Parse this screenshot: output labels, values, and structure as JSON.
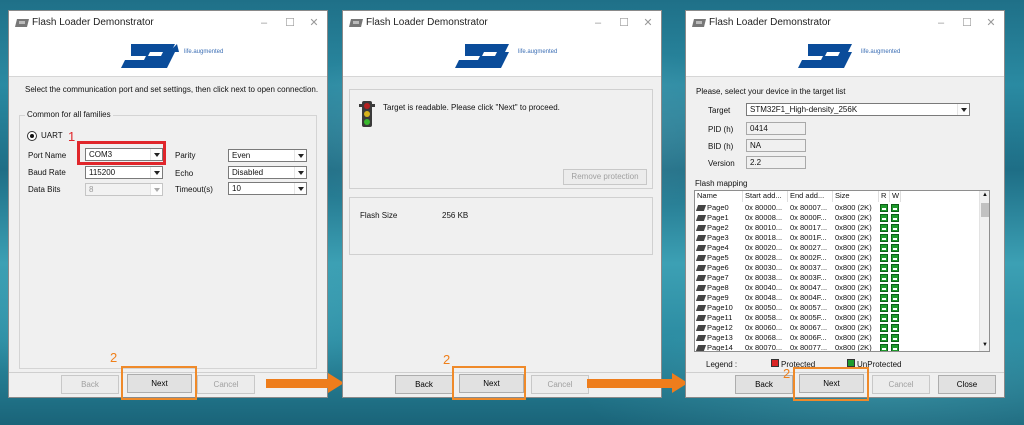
{
  "app_title": "Flash Loader Demonstrator",
  "brand": {
    "logo_text": "ST",
    "tagline": "life.augmented"
  },
  "window1": {
    "instruction": "Select the communication port and set settings, then click next to open connection.",
    "group_title": "Common for all families",
    "uart_label": "UART",
    "port_name_label": "Port Name",
    "port_name_value": "COM3",
    "baud_rate_label": "Baud Rate",
    "baud_rate_value": "115200",
    "data_bits_label": "Data Bits",
    "data_bits_value": "8",
    "parity_label": "Parity",
    "parity_value": "Even",
    "echo_label": "Echo",
    "echo_value": "Disabled",
    "timeout_label": "Timeout(s)",
    "timeout_value": "10",
    "buttons": {
      "back": "Back",
      "next": "Next",
      "cancel": "Cancel"
    }
  },
  "window2": {
    "status": "Target is readable. Please click \"Next\" to proceed.",
    "remove_protection": "Remove protection",
    "flash_size_label": "Flash Size",
    "flash_size_value": "256 KB",
    "buttons": {
      "back": "Back",
      "next": "Next",
      "cancel": "Cancel"
    }
  },
  "window3": {
    "instruction": "Please, select your device in the target list",
    "target_label": "Target",
    "target_value": "STM32F1_High-density_256K",
    "pid_label": "PID (h)",
    "pid_value": "0414",
    "bid_label": "BID (h)",
    "bid_value": "NA",
    "version_label": "Version",
    "version_value": "2.2",
    "flash_mapping_label": "Flash mapping",
    "columns": [
      "Name",
      "Start add...",
      "End add...",
      "Size",
      "R",
      "W"
    ],
    "rows": [
      {
        "name": "Page0",
        "start": "0x 80000...",
        "end": "0x 80007...",
        "size": "0x800 (2K)"
      },
      {
        "name": "Page1",
        "start": "0x 80008...",
        "end": "0x 8000F...",
        "size": "0x800 (2K)"
      },
      {
        "name": "Page2",
        "start": "0x 80010...",
        "end": "0x 80017...",
        "size": "0x800 (2K)"
      },
      {
        "name": "Page3",
        "start": "0x 80018...",
        "end": "0x 8001F...",
        "size": "0x800 (2K)"
      },
      {
        "name": "Page4",
        "start": "0x 80020...",
        "end": "0x 80027...",
        "size": "0x800 (2K)"
      },
      {
        "name": "Page5",
        "start": "0x 80028...",
        "end": "0x 8002F...",
        "size": "0x800 (2K)"
      },
      {
        "name": "Page6",
        "start": "0x 80030...",
        "end": "0x 80037...",
        "size": "0x800 (2K)"
      },
      {
        "name": "Page7",
        "start": "0x 80038...",
        "end": "0x 8003F...",
        "size": "0x800 (2K)"
      },
      {
        "name": "Page8",
        "start": "0x 80040...",
        "end": "0x 80047...",
        "size": "0x800 (2K)"
      },
      {
        "name": "Page9",
        "start": "0x 80048...",
        "end": "0x 8004F...",
        "size": "0x800 (2K)"
      },
      {
        "name": "Page10",
        "start": "0x 80050...",
        "end": "0x 80057...",
        "size": "0x800 (2K)"
      },
      {
        "name": "Page11",
        "start": "0x 80058...",
        "end": "0x 8005F...",
        "size": "0x800 (2K)"
      },
      {
        "name": "Page12",
        "start": "0x 80060...",
        "end": "0x 80067...",
        "size": "0x800 (2K)"
      },
      {
        "name": "Page13",
        "start": "0x 80068...",
        "end": "0x 8006F...",
        "size": "0x800 (2K)"
      },
      {
        "name": "Page14",
        "start": "0x 80070...",
        "end": "0x 80077...",
        "size": "0x800 (2K)"
      }
    ],
    "legend_label": "Legend :",
    "protected_label": "Protected",
    "unprotected_label": "UnProtected",
    "buttons": {
      "back": "Back",
      "next": "Next",
      "cancel": "Cancel",
      "close": "Close"
    }
  },
  "annotations": {
    "step1": "1",
    "step2": "2"
  },
  "colors": {
    "accent_orange": "#EE7D1C",
    "highlight_red": "#E0262B",
    "st_blue": "#0A4C9A"
  }
}
